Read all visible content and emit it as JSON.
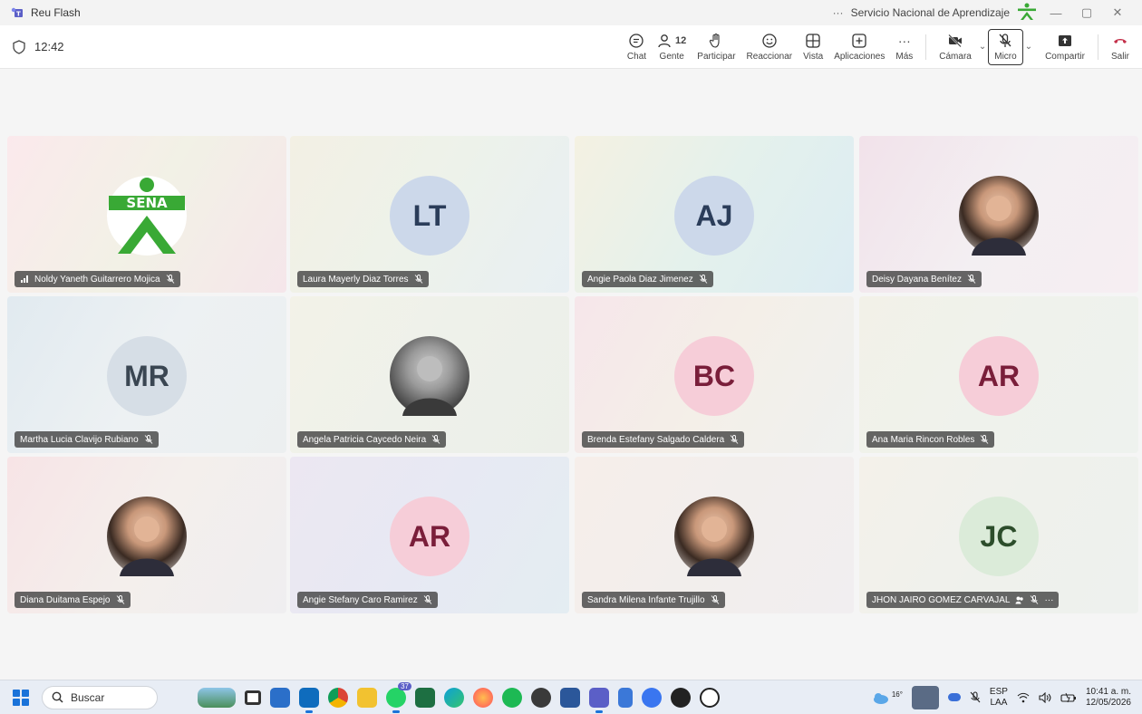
{
  "window": {
    "title": "Reu Flash",
    "organization": "Servicio Nacional de Aprendizaje",
    "more": "···",
    "minimize": "—",
    "restore": "▢",
    "close": "✕"
  },
  "meeting": {
    "elapsed": "12:42"
  },
  "toolbar": {
    "chat": "Chat",
    "people": "Gente",
    "people_count": "12",
    "raise": "Participar",
    "react": "Reaccionar",
    "view": "Vista",
    "apps": "Aplicaciones",
    "more": "Más",
    "more_glyph": "···",
    "camera": "Cámara",
    "mic": "Micro",
    "share": "Compartir",
    "leave": "Salir",
    "chevron": "⌄"
  },
  "participants": [
    {
      "name": "Noldy Yaneth Guitarrero Mojica",
      "initials": "",
      "avatar": "sena-logo",
      "bg": [
        "#fbe9ec",
        "#f2f1e6",
        "#f5e6ea"
      ]
    },
    {
      "name": "Laura Mayerly Diaz Torres",
      "initials": "LT",
      "avatar": "initials",
      "circle": "#ccd8ea",
      "fg": "#2b3d5a",
      "bg": [
        "#f3f0e4",
        "#edf2ea",
        "#e8eff3"
      ]
    },
    {
      "name": "Angie Paola Diaz Jimenez",
      "initials": "AJ",
      "avatar": "initials",
      "circle": "#ccd8ea",
      "fg": "#2b3d5a",
      "bg": [
        "#f4f1e2",
        "#e4f1ec",
        "#dcecf3"
      ]
    },
    {
      "name": "Deisy Dayana Benítez",
      "initials": "",
      "avatar": "photo",
      "bg": [
        "#f2e2ea",
        "#f3eff2",
        "#f6eef2"
      ]
    },
    {
      "name": "Martha Lucia Clavijo Rubiano",
      "initials": "MR",
      "avatar": "initials",
      "circle": "#d6dee6",
      "fg": "#3a4652",
      "bg": [
        "#e1eaf0",
        "#edf1f3",
        "#eceff0"
      ]
    },
    {
      "name": "Angela Patricia Caycedo Neira",
      "initials": "",
      "avatar": "photo-bw",
      "bg": [
        "#f3f2e8",
        "#eef1ea",
        "#ecefe9"
      ]
    },
    {
      "name": "Brenda Estefany Salgado Caldera",
      "initials": "BC",
      "avatar": "initials",
      "circle": "#f6cdd8",
      "fg": "#7a1e3a",
      "bg": [
        "#f6e6ea",
        "#f4efe8",
        "#eff1ef"
      ]
    },
    {
      "name": "Ana Maria Rincon Robles",
      "initials": "AR",
      "avatar": "initials",
      "circle": "#f6cdd8",
      "fg": "#7a1e3a",
      "bg": [
        "#f2f1e8",
        "#eff2ec",
        "#eef2ee"
      ]
    },
    {
      "name": "Diana Duitama Espejo",
      "initials": "",
      "avatar": "photo",
      "bg": [
        "#f7e4e6",
        "#f4efec",
        "#efeef0"
      ]
    },
    {
      "name": "Angie Stefany Caro Ramirez",
      "initials": "AR",
      "avatar": "initials",
      "circle": "#f6cdd8",
      "fg": "#7a1e3a",
      "bg": [
        "#ece7f2",
        "#e7e9f3",
        "#e4edf2"
      ]
    },
    {
      "name": "Sandra Milena Infante Trujillo",
      "initials": "",
      "avatar": "photo",
      "bg": [
        "#f6eeea",
        "#f2eeec",
        "#f1eef0"
      ]
    },
    {
      "name": "JHON JAIRO GOMEZ CARVAJAL",
      "initials": "JC",
      "avatar": "initials",
      "circle": "#dbebd9",
      "fg": "#2c4d2b",
      "bg": [
        "#f4f1ea",
        "#eff1ec",
        "#eef1ee"
      ],
      "extra": "···"
    }
  ],
  "taskbar": {
    "search_placeholder": "Buscar",
    "whatsapp_badge": "37",
    "weather_temp": "16°",
    "language": "ESP",
    "layout": "LAA",
    "time": "10:41 a. m.",
    "date": "12/05/2026"
  },
  "colors": {
    "accent": "#5b5fc7",
    "sena_green": "#39a935",
    "leave_red": "#c4314b",
    "windows_blue": "#1a73d9"
  }
}
